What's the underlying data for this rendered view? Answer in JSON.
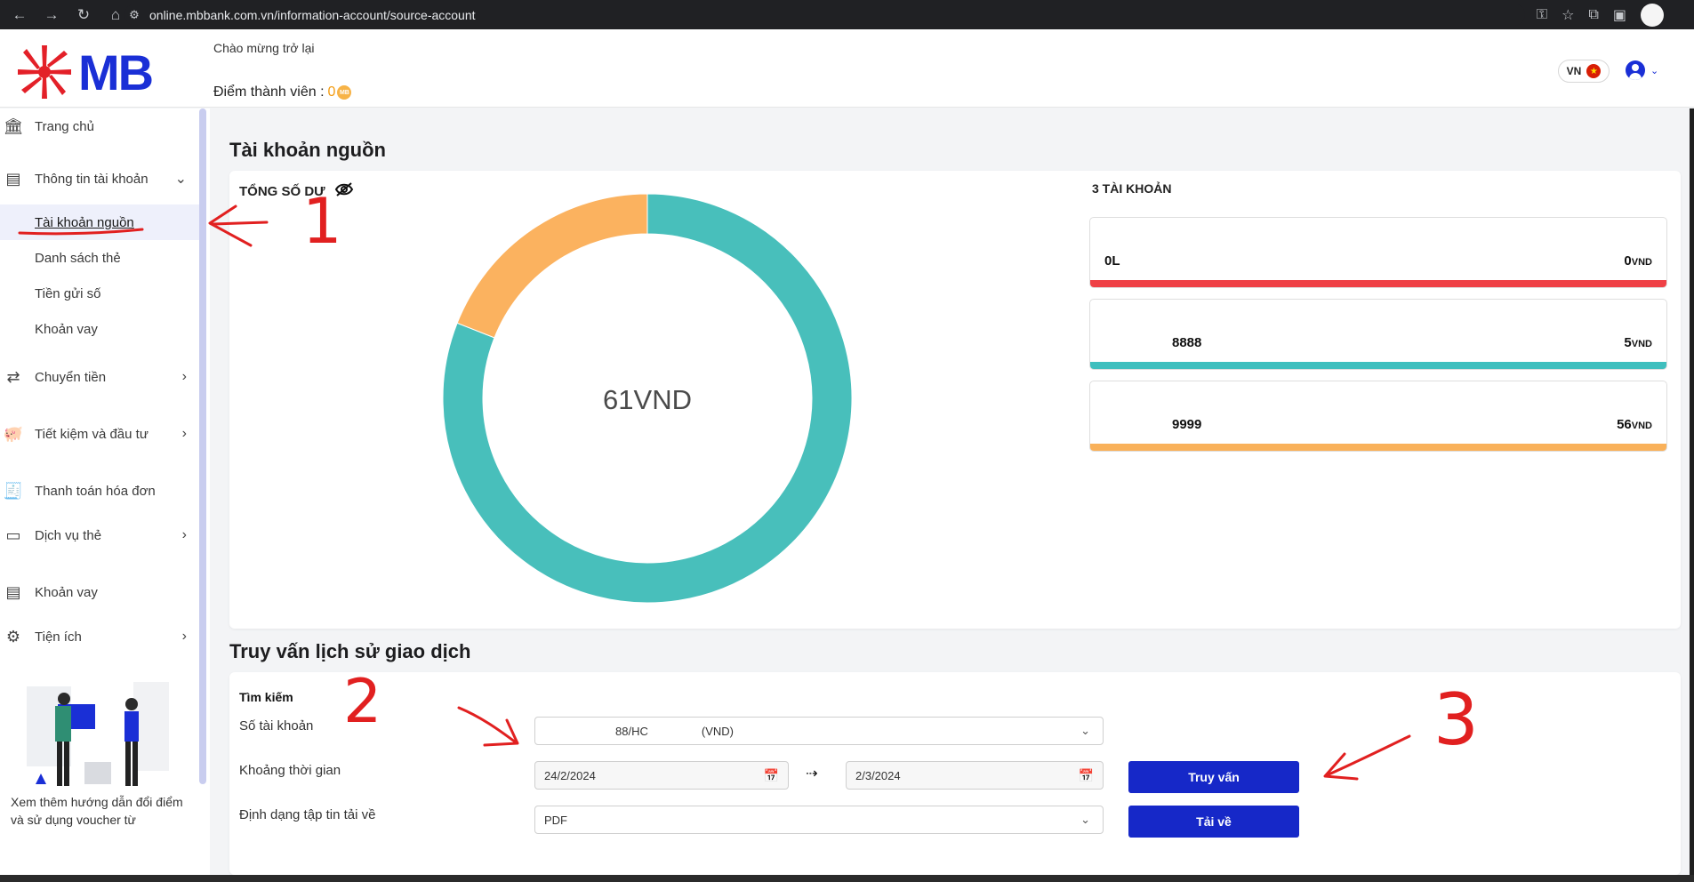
{
  "browser": {
    "url": "online.mbbank.com.vn/information-account/source-account"
  },
  "header": {
    "logo": "MB",
    "welcome": "Chào mừng trở lại",
    "points_label": "Điểm thành viên :",
    "points_value": "0",
    "language": "VN"
  },
  "sidebar": {
    "items": [
      {
        "label": "Trang chủ",
        "icon": "bank-icon"
      },
      {
        "label": "Thông tin tài khoản",
        "icon": "account-info-icon"
      },
      {
        "label": "Chuyển tiền",
        "icon": "transfer-icon"
      },
      {
        "label": "Tiết kiệm và đầu tư",
        "icon": "piggy-bank-icon"
      },
      {
        "label": "Thanh toán hóa đơn",
        "icon": "bill-icon"
      },
      {
        "label": "Dịch vụ thẻ",
        "icon": "card-icon"
      },
      {
        "label": "Khoản vay",
        "icon": "loan-icon"
      },
      {
        "label": "Tiện ích",
        "icon": "utility-icon"
      }
    ],
    "sub_items": [
      {
        "label": "Tài khoản nguồn",
        "active": true
      },
      {
        "label": "Danh sách thẻ"
      },
      {
        "label": "Tiền gửi số"
      },
      {
        "label": "Khoản vay"
      }
    ],
    "promo_text": "Xem thêm hướng dẫn đổi điểm và sử dụng voucher từ"
  },
  "source_account": {
    "title": "Tài khoản nguồn",
    "total_label": "TỔNG SỐ DƯ",
    "total_value": "61VND",
    "account_count_label": "3 TÀI KHOẢN",
    "accounts": [
      {
        "name": "0L",
        "number": "",
        "balance": "0",
        "unit": "VND",
        "color": "#ef4045"
      },
      {
        "name": "",
        "number": "8888",
        "balance": "5",
        "unit": "VND",
        "color": "#3fbfbe"
      },
      {
        "name": "",
        "number": "9999",
        "balance": "56",
        "unit": "VND",
        "color": "#f9b15a"
      }
    ]
  },
  "chart_data": {
    "type": "pie",
    "labels": [
      "",
      ""
    ],
    "colors": [
      "#48bfbb",
      "#fbb25f"
    ],
    "values": [
      0.81,
      0.19
    ]
  },
  "history": {
    "title": "Truy vấn lịch sử giao dịch",
    "search_title": "Tìm kiếm",
    "account_label": "Số tài khoản",
    "account_value": "88/HC",
    "account_currency": "(VND)",
    "period_label": "Khoảng thời gian",
    "date_from": "24/2/2024",
    "date_to": "2/3/2024",
    "format_label": "Định dạng tập tin tải về",
    "format_value": "PDF",
    "query_button": "Truy vấn",
    "download_button": "Tải về"
  },
  "annotations": {
    "one": "1",
    "two": "2",
    "three": "3",
    "color": "#e12020"
  }
}
